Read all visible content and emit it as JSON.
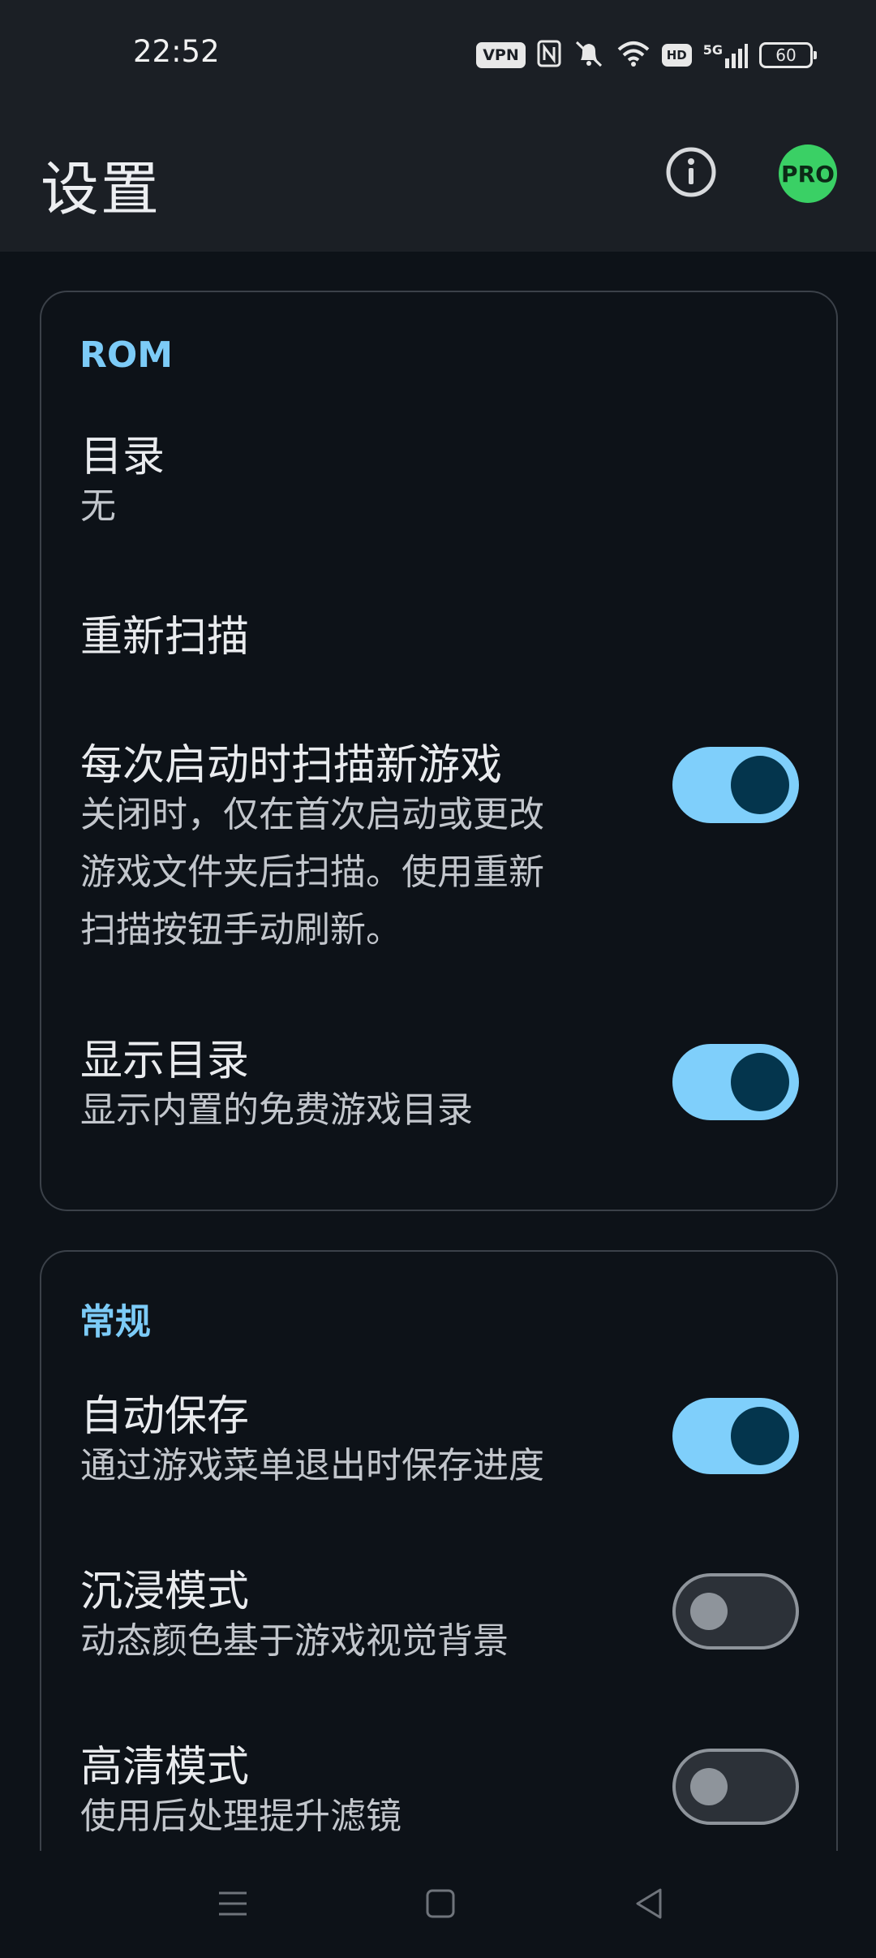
{
  "status": {
    "time": "22:52",
    "vpn": "VPN",
    "hd": "HD",
    "network": "5G",
    "battery": "60"
  },
  "header": {
    "title": "设置",
    "pro_label": "PRO"
  },
  "rom": {
    "section_title": "ROM",
    "directory_title": "目录",
    "directory_value": "无",
    "rescan_title": "重新扫描",
    "scan_on_start_title": "每次启动时扫描新游戏",
    "scan_on_start_sub_1": "关闭时，仅在首次启动或更改",
    "scan_on_start_sub_2": "游戏文件夹后扫描。使用重新",
    "scan_on_start_sub_3": "扫描按钮手动刷新。",
    "scan_on_start_enabled": true,
    "show_catalog_title": "显示目录",
    "show_catalog_sub": "显示内置的免费游戏目录",
    "show_catalog_enabled": true
  },
  "general": {
    "section_title": "常规",
    "autosave_title": "自动保存",
    "autosave_sub": "通过游戏菜单退出时保存进度",
    "autosave_enabled": true,
    "immersive_title": "沉浸模式",
    "immersive_sub": "动态颜色基于游戏视觉背景",
    "immersive_enabled": false,
    "hd_title": "高清模式",
    "hd_sub": "使用后处理提升滤镜",
    "hd_enabled": false
  },
  "colors": {
    "accent": "#7ccbf7",
    "toggle_on": "#7fcffb",
    "pro_badge": "#3ad065",
    "background": "#0d1218",
    "appbar": "#1b1f25"
  }
}
